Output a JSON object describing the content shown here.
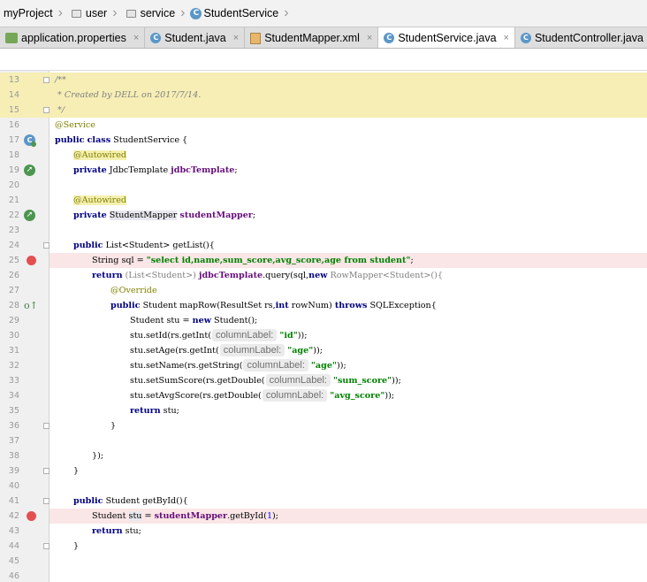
{
  "breadcrumbs": [
    {
      "label": "myProject",
      "icon": "folder-icon"
    },
    {
      "label": "user",
      "icon": "folder-icon"
    },
    {
      "label": "service",
      "icon": "folder-icon"
    },
    {
      "label": "StudentService",
      "icon": "class-icon"
    }
  ],
  "tabs": [
    {
      "label": "application.properties",
      "icon": "properties-file-icon",
      "close": "×",
      "active": false
    },
    {
      "label": "Student.java",
      "icon": "class-icon",
      "close": "×",
      "active": false
    },
    {
      "label": "StudentMapper.xml",
      "icon": "xml-file-icon",
      "close": "×",
      "active": false
    },
    {
      "label": "StudentService.java",
      "icon": "class-icon",
      "close": "×",
      "active": true
    },
    {
      "label": "StudentController.java",
      "icon": "class-icon",
      "close": "×",
      "active": false
    }
  ],
  "colors": {
    "comment_bg": "#f6eeb5",
    "breakpoint": "#e35050",
    "keyword": "#000080",
    "string": "#008000",
    "field": "#660e7a",
    "annotation": "#808000"
  },
  "code_lines": [
    {
      "number": "13",
      "text": "/**"
    },
    {
      "number": "14",
      "text": " * Created by DELL on 2017/7/14."
    },
    {
      "number": "15",
      "text": " */"
    },
    {
      "number": "16",
      "text": "@Service"
    },
    {
      "number": "17",
      "text": "public class StudentService {"
    },
    {
      "number": "18",
      "text": "    @Autowired"
    },
    {
      "number": "19",
      "text": "    private JdbcTemplate jdbcTemplate;"
    },
    {
      "number": "20",
      "text": ""
    },
    {
      "number": "21",
      "text": "    @Autowired"
    },
    {
      "number": "22",
      "text": "    private StudentMapper studentMapper;"
    },
    {
      "number": "23",
      "text": ""
    },
    {
      "number": "24",
      "text": "    public List<Student> getList(){"
    },
    {
      "number": "25",
      "text": "        String sql = \"select id,name,sum_score,avg_score,age from student\";"
    },
    {
      "number": "26",
      "text": "        return (List<Student>) jdbcTemplate.query(sql,new RowMapper<Student>(){"
    },
    {
      "number": "27",
      "text": "            @Override"
    },
    {
      "number": "28",
      "text": "            public Student mapRow(ResultSet rs,int rowNum) throws SQLException{"
    },
    {
      "number": "29",
      "text": "                Student stu = new Student();"
    },
    {
      "number": "30",
      "text": "                stu.setId(rs.getInt( columnLabel: \"id\"));"
    },
    {
      "number": "31",
      "text": "                stu.setAge(rs.getInt( columnLabel: \"age\"));"
    },
    {
      "number": "32",
      "text": "                stu.setName(rs.getString( columnLabel: \"age\"));"
    },
    {
      "number": "33",
      "text": "                stu.setSumScore(rs.getDouble( columnLabel: \"sum_score\"));"
    },
    {
      "number": "34",
      "text": "                stu.setAvgScore(rs.getDouble( columnLabel: \"avg_score\"));"
    },
    {
      "number": "35",
      "text": "                return stu;"
    },
    {
      "number": "36",
      "text": "            }"
    },
    {
      "number": "37",
      "text": ""
    },
    {
      "number": "38",
      "text": "        });"
    },
    {
      "number": "39",
      "text": "    }"
    },
    {
      "number": "40",
      "text": ""
    },
    {
      "number": "41",
      "text": "    public Student getById(){"
    },
    {
      "number": "42",
      "text": "        Student stu = studentMapper.getById(1);"
    },
    {
      "number": "43",
      "text": "        return stu;"
    },
    {
      "number": "44",
      "text": "    }"
    },
    {
      "number": "45",
      "text": ""
    },
    {
      "number": "46",
      "text": ""
    }
  ],
  "tokens": {
    "l13": [
      "/**"
    ],
    "l14": [
      " * Created by DELL on 2017/7/14."
    ],
    "l15": [
      " */"
    ],
    "l16": [
      "@Service"
    ],
    "l17": [
      "public",
      "class",
      "StudentService {"
    ],
    "l18": [
      "@Autowired"
    ],
    "l19": [
      "private",
      "JdbcTemplate",
      "jdbcTemplate",
      ";"
    ],
    "l21": [
      "@Autowired"
    ],
    "l22": [
      "private",
      "StudentMapper",
      "studentMapper",
      ";"
    ],
    "l24": [
      "public",
      "List",
      "<Student>",
      "getList(){"
    ],
    "l25": [
      "String sql = ",
      "\"select id,name,sum_score,avg_score,age from student\"",
      ";"
    ],
    "l26": [
      "return",
      "(List<Student>)",
      "jdbcTemplate",
      ".query(sql,",
      "new",
      "RowMapper<Student>(){"
    ],
    "l27": [
      "@Override"
    ],
    "l28": [
      "public",
      "Student mapRow(ResultSet rs,",
      "int",
      "rowNum)",
      "throws",
      "SQLException{"
    ],
    "l29": [
      "Student stu = ",
      "new",
      "Student();"
    ],
    "l30": [
      "stu.setId(rs.getInt(",
      "columnLabel:",
      "\"id\"",
      "));"
    ],
    "l31": [
      "stu.setAge(rs.getInt(",
      "columnLabel:",
      "\"age\"",
      "));"
    ],
    "l32": [
      "stu.setName(rs.getString(",
      "columnLabel:",
      "\"age\"",
      "));"
    ],
    "l33": [
      "stu.setSumScore(rs.getDouble(",
      "columnLabel:",
      "\"sum_score\"",
      "));"
    ],
    "l34": [
      "stu.setAvgScore(rs.getDouble(",
      "columnLabel:",
      "\"avg_score\"",
      "));"
    ],
    "l35": [
      "return",
      "stu;"
    ],
    "l36": [
      "}"
    ],
    "l38": [
      "});"
    ],
    "l39": [
      "}"
    ],
    "l41": [
      "public",
      "Student getById(){"
    ],
    "l42": [
      "Student ",
      "stu",
      " = ",
      "studentMapper",
      ".getById(",
      "1",
      ");"
    ],
    "l43": [
      "return",
      "stu;"
    ],
    "l44": [
      "}"
    ]
  }
}
